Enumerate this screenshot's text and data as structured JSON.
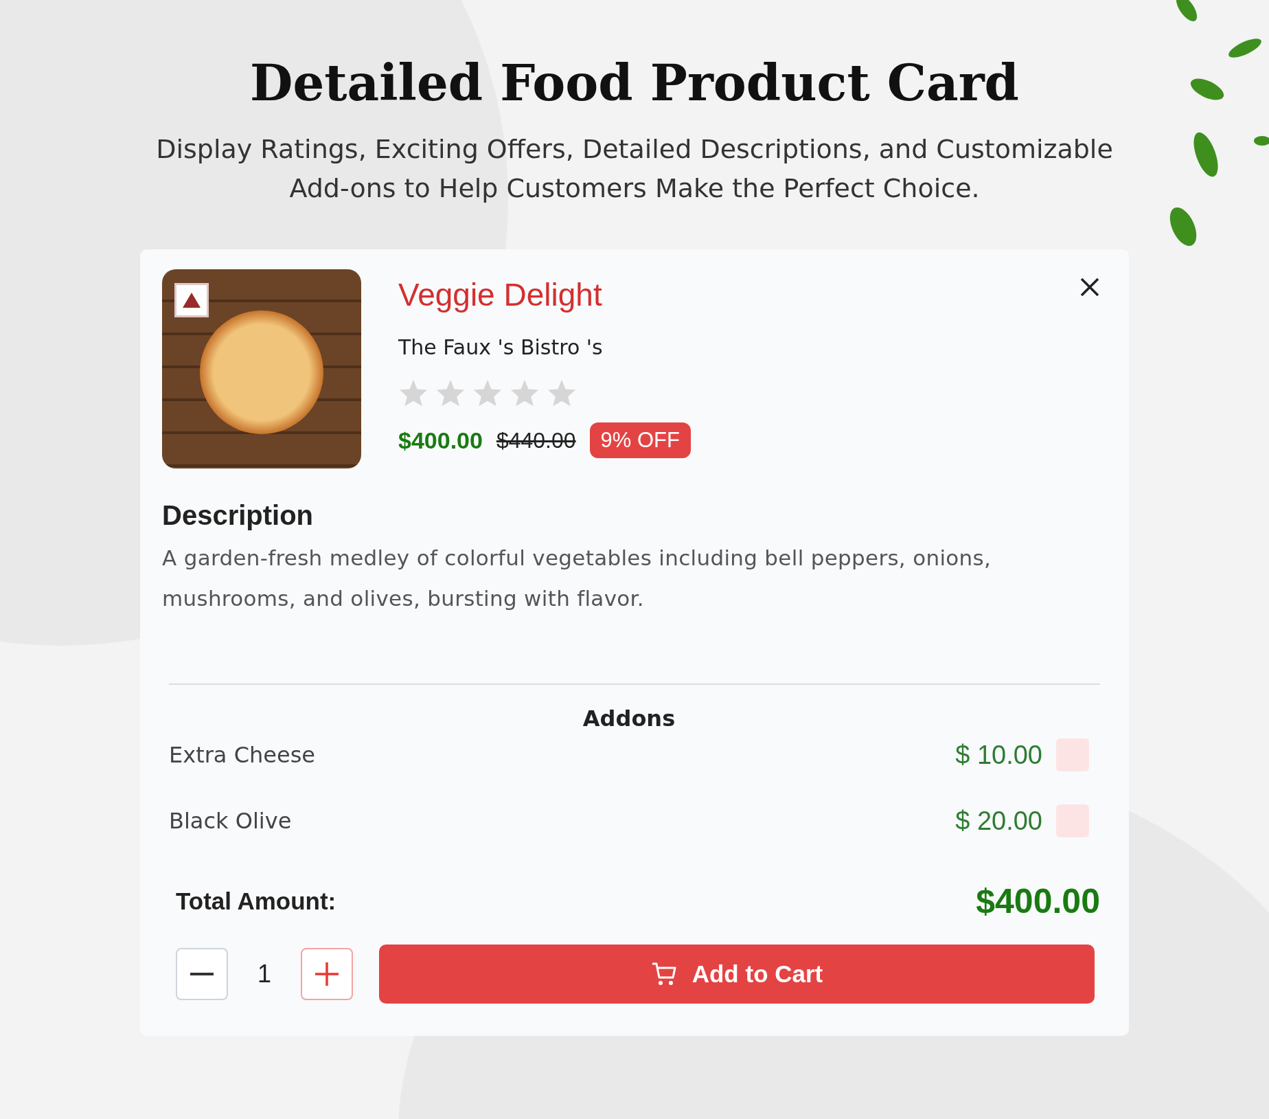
{
  "header": {
    "title": "Detailed Food Product Card",
    "subtitle": "Display Ratings, Exciting Offers, Detailed Descriptions, and Customizable Add-ons to Help Customers Make the Perfect Choice."
  },
  "product": {
    "name": "Veggie Delight",
    "restaurant": "The Faux 's Bistro 's",
    "stars": 0,
    "price": "$400.00",
    "old_price": "$440.00",
    "discount": "9% OFF",
    "veg": false
  },
  "description": {
    "heading": "Description",
    "text": "A garden-fresh medley of colorful vegetables including bell peppers, onions, mushrooms, and olives, bursting with flavor."
  },
  "addons": {
    "heading": "Addons",
    "items": [
      {
        "name": "Extra Cheese",
        "price": "$ 10.00",
        "checked": false
      },
      {
        "name": "Black Olive",
        "price": "$ 20.00",
        "checked": false
      }
    ]
  },
  "total": {
    "label": "Total Amount:",
    "value": "$400.00"
  },
  "quantity": "1",
  "cart_button": "Add to Cart"
}
